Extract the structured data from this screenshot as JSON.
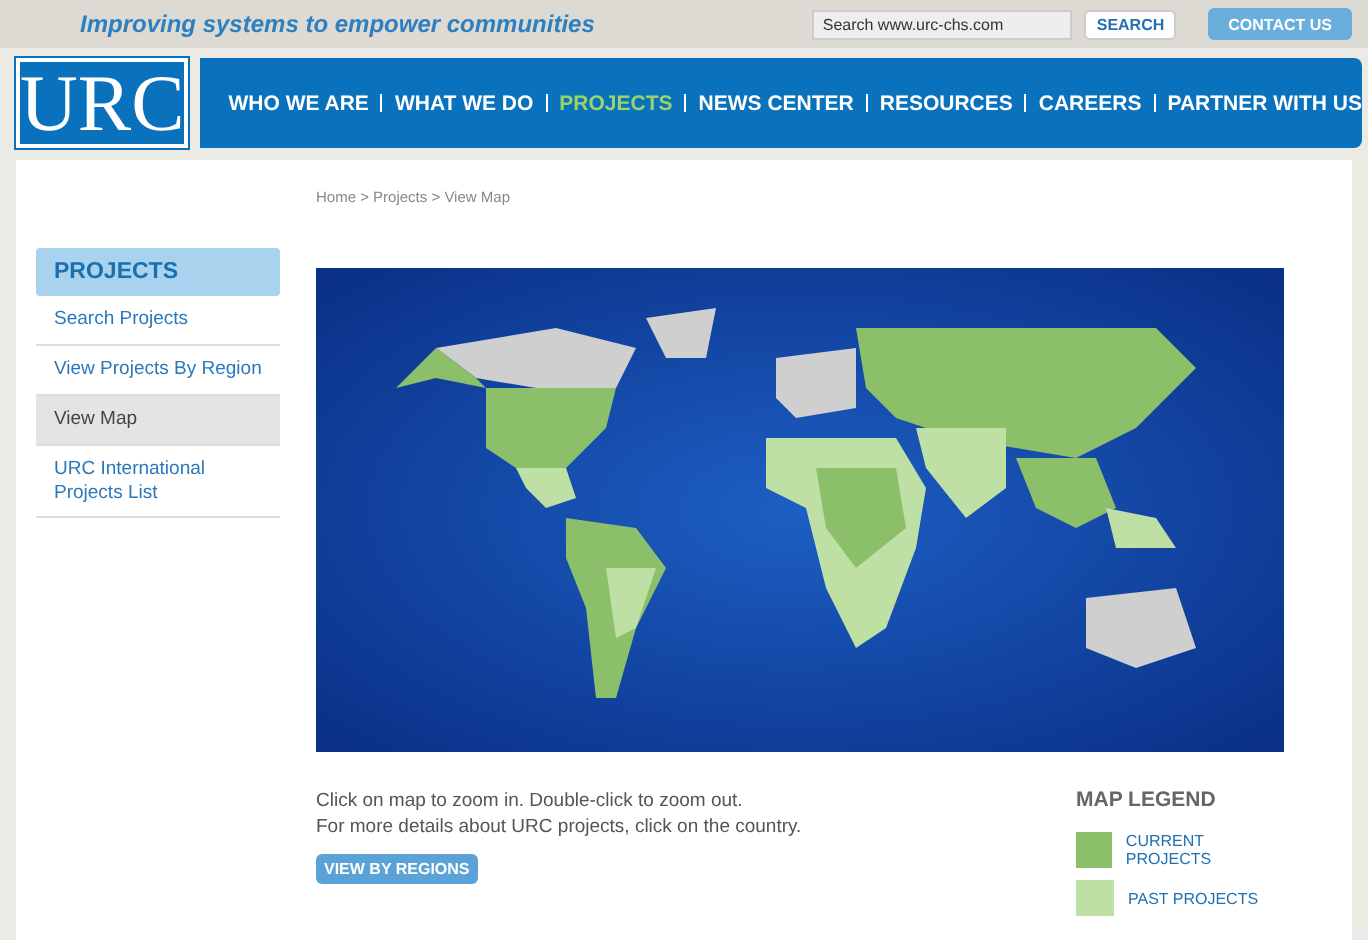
{
  "top_bar": {
    "tagline": "Improving systems to empower communities",
    "search": {
      "placeholder": "Search www.urc-chs.com"
    },
    "search_button": "SEARCH",
    "contact_button": "CONTACT US"
  },
  "header": {
    "logo": "URC",
    "nav": [
      {
        "label": "WHO WE ARE",
        "selected": false
      },
      {
        "label": "WHAT WE DO",
        "selected": false
      },
      {
        "label": "PROJECTS",
        "selected": true
      },
      {
        "label": "NEWS CENTER",
        "selected": false
      },
      {
        "label": "RESOURCES",
        "selected": false
      },
      {
        "label": "CAREERS",
        "selected": false
      },
      {
        "label": "PARTNER WITH US",
        "selected": false
      }
    ]
  },
  "breadcrumb": "Home > Projects > View Map",
  "sidebar": {
    "title": "PROJECTS",
    "items": [
      {
        "label": "Search Projects",
        "selected": false
      },
      {
        "label": "View Projects By Region",
        "selected": false
      },
      {
        "label": "View Map",
        "selected": true
      },
      {
        "label": "URC International Projects List",
        "selected": false
      }
    ]
  },
  "instructions": [
    "Click on map to zoom in. Double-click to zoom out.",
    "For more details about URC projects, click on the country."
  ],
  "view_button": "VIEW BY REGIONS",
  "legend": {
    "title": "MAP LEGEND",
    "items": [
      {
        "label": "CURRENT PROJECTS",
        "color": "#8cbf6a"
      },
      {
        "label": "PAST PROJECTS",
        "color": "#bfe0a4"
      }
    ]
  }
}
